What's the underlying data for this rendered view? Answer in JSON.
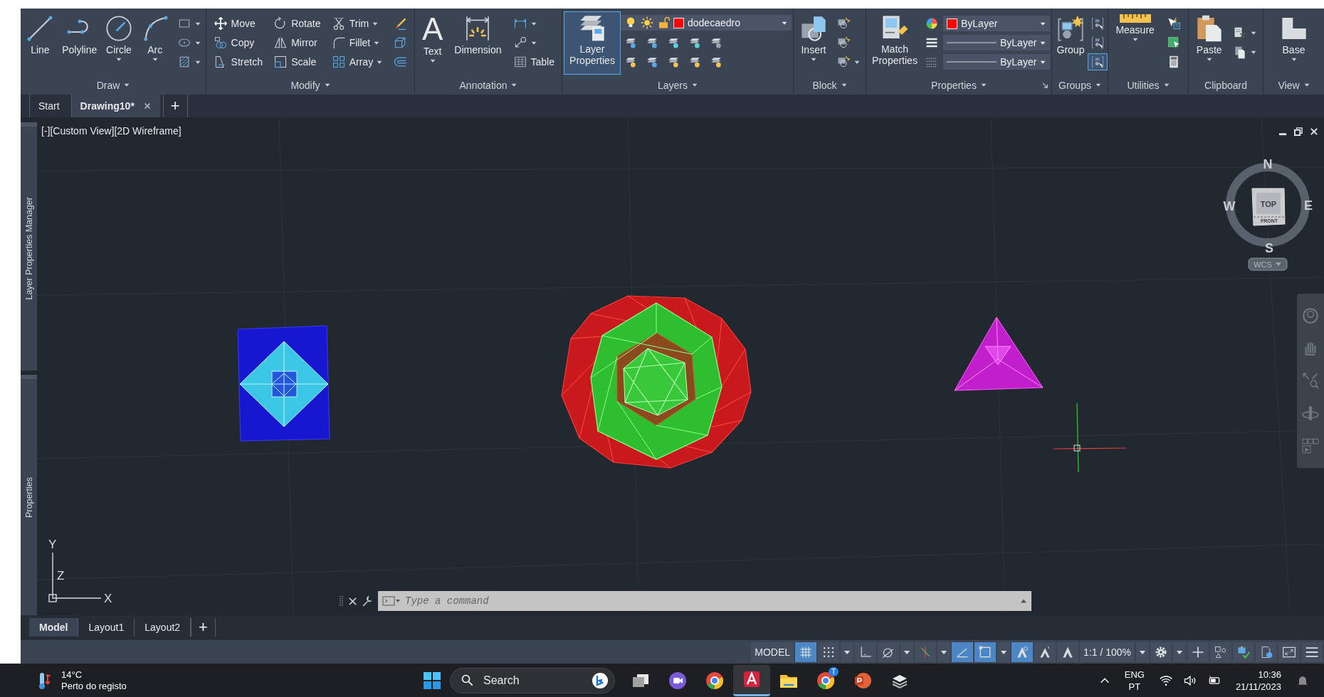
{
  "ribbon": {
    "panels": [
      {
        "title": "Draw",
        "menu": true,
        "launcher": false,
        "columns": [
          {
            "rows": [
              [
                {
                  "kind": "large",
                  "label": "Line",
                  "caret": false,
                  "active": false
                }
              ]
            ]
          },
          {
            "rows": [
              [
                {
                  "kind": "large",
                  "label": "Polyline",
                  "caret": false,
                  "active": false
                }
              ]
            ]
          },
          {
            "rows": [
              [
                {
                  "kind": "large",
                  "label": "Circle",
                  "caret": true,
                  "active": false
                }
              ]
            ]
          },
          {
            "rows": [
              [
                {
                  "kind": "large",
                  "label": "Arc",
                  "caret": true,
                  "active": false
                }
              ]
            ]
          },
          {
            "rows": [
              [
                {
                  "kind": "small",
                  "caret": true,
                  "active": false
                }
              ],
              [
                {
                  "kind": "small",
                  "caret": true,
                  "active": false
                }
              ],
              [
                {
                  "kind": "small",
                  "caret": true,
                  "active": false
                }
              ]
            ]
          }
        ]
      },
      {
        "title": "Modify",
        "menu": true,
        "launcher": false,
        "columns": [
          {
            "rows": [
              [
                {
                  "kind": "small",
                  "label": "Move",
                  "caret": false,
                  "active": false
                }
              ],
              [
                {
                  "kind": "small",
                  "label": "Copy",
                  "caret": false,
                  "active": false
                }
              ],
              [
                {
                  "kind": "small",
                  "label": "Stretch",
                  "caret": false,
                  "active": false
                }
              ]
            ]
          },
          {
            "rows": [
              [
                {
                  "kind": "small",
                  "label": "Rotate",
                  "caret": false,
                  "active": false
                }
              ],
              [
                {
                  "kind": "small",
                  "label": "Mirror",
                  "caret": false,
                  "active": false
                }
              ],
              [
                {
                  "kind": "small",
                  "label": "Scale",
                  "caret": false,
                  "active": false
                }
              ]
            ]
          },
          {
            "rows": [
              [
                {
                  "kind": "small",
                  "label": "Trim",
                  "caret": true,
                  "active": false
                }
              ],
              [
                {
                  "kind": "small",
                  "label": "Fillet",
                  "caret": true,
                  "active": false
                }
              ],
              [
                {
                  "kind": "small",
                  "label": "Array",
                  "caret": true,
                  "active": false
                }
              ]
            ]
          },
          {
            "rows": [
              [
                {
                  "kind": "small",
                  "caret": false,
                  "active": false
                }
              ],
              [
                {
                  "kind": "small",
                  "caret": false,
                  "active": false
                }
              ],
              [
                {
                  "kind": "small",
                  "caret": false,
                  "active": false
                }
              ]
            ]
          }
        ]
      },
      {
        "title": "Annotation",
        "menu": true,
        "launcher": false,
        "columns": [
          {
            "rows": [
              [
                {
                  "kind": "glyph",
                  "glyph": "A",
                  "label": "Text",
                  "caret": true,
                  "active": false
                }
              ]
            ]
          },
          {
            "rows": [
              [
                {
                  "kind": "large",
                  "label": "Dimension",
                  "caret": false,
                  "active": false
                }
              ]
            ]
          },
          {
            "rows": [
              [
                {
                  "kind": "small",
                  "caret": true,
                  "active": false
                }
              ],
              [
                {
                  "kind": "small",
                  "caret": true,
                  "active": false
                }
              ],
              [
                {
                  "kind": "small",
                  "label": "Table",
                  "caret": false,
                  "active": false
                }
              ]
            ]
          }
        ]
      },
      {
        "title": "Layers",
        "menu": true,
        "launcher": false,
        "columns": [
          {
            "rows": [
              [
                {
                  "kind": "large",
                  "label": "Layer Properties",
                  "caret": false,
                  "active": true
                }
              ]
            ]
          },
          {
            "rows": [
              [
                {
                  "kind": "layercombo",
                  "value": "dodecaedro",
                  "on": true,
                  "frozen": false,
                  "locked": false,
                  "color": "#ff0000"
                }
              ],
              [
                {
                  "kind": "small",
                  "caret": false,
                  "active": false
                },
                {
                  "kind": "small",
                  "caret": false,
                  "active": false
                },
                {
                  "kind": "small",
                  "caret": false,
                  "active": false
                },
                {
                  "kind": "small",
                  "caret": false,
                  "active": false
                },
                {
                  "kind": "small",
                  "caret": false,
                  "active": false
                }
              ],
              [
                {
                  "kind": "small",
                  "caret": false,
                  "active": false
                },
                {
                  "kind": "small",
                  "caret": false,
                  "active": false
                },
                {
                  "kind": "small",
                  "caret": false,
                  "active": false
                },
                {
                  "kind": "small",
                  "caret": false,
                  "active": false
                },
                {
                  "kind": "small",
                  "caret": false,
                  "active": false
                }
              ]
            ]
          }
        ]
      },
      {
        "title": "Block",
        "menu": true,
        "launcher": false,
        "columns": [
          {
            "rows": [
              [
                {
                  "kind": "large",
                  "label": "Insert",
                  "caret": true,
                  "active": false
                }
              ]
            ]
          },
          {
            "rows": [
              [
                {
                  "kind": "small",
                  "caret": false,
                  "active": false
                }
              ],
              [
                {
                  "kind": "small",
                  "caret": false,
                  "active": false
                }
              ],
              [
                {
                  "kind": "small",
                  "caret": true,
                  "active": false
                }
              ]
            ]
          }
        ]
      },
      {
        "title": "Properties",
        "menu": true,
        "launcher": true,
        "columns": [
          {
            "rows": [
              [
                {
                  "kind": "large",
                  "label": "Match Properties",
                  "caret": false,
                  "active": false
                }
              ]
            ]
          },
          {
            "rows": [
              [
                {
                  "kind": "small",
                  "caret": false,
                  "active": false
                },
                {
                  "kind": "colorcombo",
                  "value": "ByLayer",
                  "color": "#ff0000"
                }
              ],
              [
                {
                  "kind": "small",
                  "caret": false,
                  "active": false
                },
                {
                  "kind": "linecombo",
                  "value": "ByLayer"
                }
              ],
              [
                {
                  "kind": "small",
                  "caret": false,
                  "active": false
                },
                {
                  "kind": "linecombo",
                  "value": "ByLayer"
                }
              ]
            ]
          }
        ]
      },
      {
        "title": "Groups",
        "menu": true,
        "launcher": false,
        "columns": [
          {
            "rows": [
              [
                {
                  "kind": "large",
                  "label": "Group",
                  "caret": false,
                  "active": false
                }
              ]
            ]
          },
          {
            "rows": [
              [
                {
                  "kind": "small",
                  "caret": false,
                  "active": false
                }
              ],
              [
                {
                  "kind": "small",
                  "caret": false,
                  "active": false
                }
              ],
              [
                {
                  "kind": "small",
                  "caret": false,
                  "active": true
                }
              ]
            ]
          }
        ]
      },
      {
        "title": "Utilities",
        "menu": true,
        "launcher": false,
        "columns": [
          {
            "rows": [
              [
                {
                  "kind": "large",
                  "label": "Measure",
                  "caret": true,
                  "active": false
                }
              ]
            ]
          },
          {
            "rows": [
              [
                {
                  "kind": "small",
                  "caret": false,
                  "active": false
                }
              ],
              [
                {
                  "kind": "small",
                  "caret": false,
                  "active": false
                }
              ],
              [
                {
                  "kind": "small",
                  "caret": false,
                  "active": false
                }
              ]
            ]
          }
        ]
      },
      {
        "title": "Clipboard",
        "menu": false,
        "launcher": false,
        "columns": [
          {
            "rows": [
              [
                {
                  "kind": "large",
                  "label": "Paste",
                  "caret": true,
                  "active": false
                }
              ]
            ]
          },
          {
            "rows": [
              [
                {
                  "kind": "small",
                  "caret": true,
                  "active": false
                }
              ],
              [
                {
                  "kind": "small",
                  "caret": true,
                  "active": false
                }
              ]
            ]
          }
        ]
      },
      {
        "title": "View",
        "menu": true,
        "launcher": false,
        "columns": [
          {
            "rows": [
              [
                {
                  "kind": "large",
                  "label": "Base",
                  "caret": true,
                  "active": false
                }
              ]
            ]
          }
        ]
      }
    ]
  },
  "file_tabs": {
    "tabs": [
      {
        "label": "Start",
        "selected": false,
        "closable": false
      },
      {
        "label": "Drawing10*",
        "selected": true,
        "closable": true
      }
    ],
    "add": "+"
  },
  "palettes": [
    {
      "label": "Layer Properties Manager"
    },
    {
      "label": "Properties"
    }
  ],
  "viewport": {
    "label": "[-][Custom View][2D Wireframe]",
    "ucs": {
      "y": "Y",
      "z": "Z",
      "x": "X"
    },
    "viewcube": {
      "north": "N",
      "west": "W",
      "east": "E",
      "south": "S",
      "top": "TOP",
      "front": "FRONT",
      "wcs": "WCS"
    },
    "command_line": {
      "placeholder": "Type a command"
    }
  },
  "layout_tabs": {
    "tabs": [
      {
        "label": "Model",
        "selected": true
      },
      {
        "label": "Layout1",
        "selected": false
      },
      {
        "label": "Layout2",
        "selected": false
      }
    ],
    "add": "+"
  },
  "status_bar": {
    "items": [
      {
        "kind": "text",
        "label": "MODEL"
      },
      {
        "kind": "icon",
        "active": true
      },
      {
        "kind": "icon",
        "active": false
      },
      {
        "kind": "caret"
      },
      {
        "kind": "icon",
        "active": false
      },
      {
        "kind": "icon",
        "active": false
      },
      {
        "kind": "caret"
      },
      {
        "kind": "icon",
        "active": false
      },
      {
        "kind": "caret"
      },
      {
        "kind": "icon",
        "active": true
      },
      {
        "kind": "icon",
        "active": true
      },
      {
        "kind": "caret"
      },
      {
        "kind": "icon",
        "active": true
      },
      {
        "kind": "icon",
        "active": false
      },
      {
        "kind": "icon",
        "active": false
      },
      {
        "kind": "text",
        "label": "1:1 / 100%"
      },
      {
        "kind": "caret"
      },
      {
        "kind": "icon",
        "active": false
      },
      {
        "kind": "caret"
      },
      {
        "kind": "icon",
        "active": false
      },
      {
        "kind": "icon",
        "active": false
      },
      {
        "kind": "icon",
        "active": false
      },
      {
        "kind": "icon",
        "active": false
      },
      {
        "kind": "icon",
        "active": false
      },
      {
        "kind": "icon",
        "active": false
      }
    ]
  },
  "taskbar": {
    "weather": {
      "temperature": "14°C",
      "text": "Perto do registo"
    },
    "search": {
      "placeholder": "Search"
    },
    "apps": [
      {
        "selected": false
      },
      {
        "selected": false
      },
      {
        "selected": false
      },
      {
        "selected": true
      },
      {
        "selected": false
      },
      {
        "selected": false,
        "badge": "T"
      },
      {
        "selected": false
      },
      {
        "selected": false
      }
    ],
    "tray": {
      "language": "ENG",
      "region": "PT",
      "time": "10:36",
      "date": "21/11/2023"
    }
  }
}
